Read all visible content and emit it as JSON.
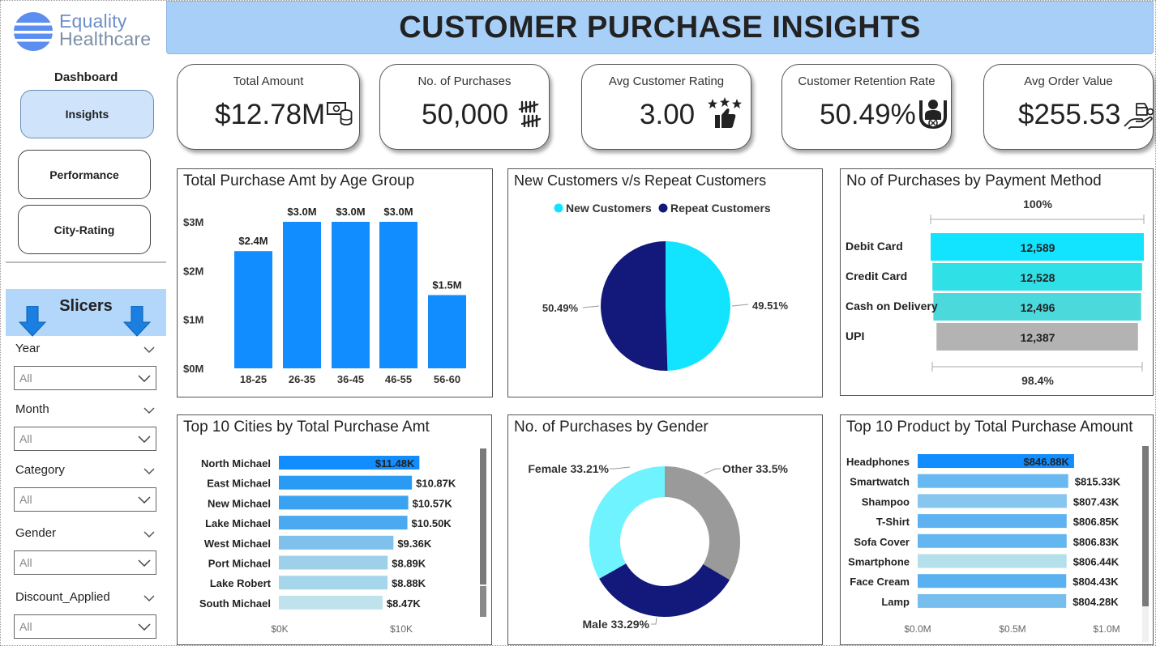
{
  "logo": {
    "line1": "Equality",
    "line2": "Healthcare"
  },
  "header": {
    "title": "CUSTOMER PURCHASE INSIGHTS"
  },
  "nav": {
    "title": "Dashboard",
    "items": [
      {
        "label": "Insights",
        "active": true
      },
      {
        "label": "Performance",
        "active": false
      },
      {
        "label": "City-Rating",
        "active": false
      }
    ]
  },
  "slicers": {
    "title": "Slicers",
    "items": [
      {
        "label": "Year",
        "value": "All"
      },
      {
        "label": "Month",
        "value": "All"
      },
      {
        "label": "Category",
        "value": "All"
      },
      {
        "label": "Gender",
        "value": "All"
      },
      {
        "label": "Discount_Applied",
        "value": "All"
      }
    ]
  },
  "kpis": [
    {
      "label": "Total Amount",
      "value": "$12.78M",
      "icon": "money-stack-icon"
    },
    {
      "label": "No. of Purchases",
      "value": "50,000",
      "icon": "tally-marks-icon"
    },
    {
      "label": "Avg Customer Rating",
      "value": "3.00",
      "icon": "rating-thumbs-up-icon"
    },
    {
      "label": "Customer Retention Rate",
      "value": "50.49%",
      "icon": "retention-person-icon"
    },
    {
      "label": "Avg Order Value",
      "value": "$255.53",
      "icon": "hand-coin-box-icon"
    }
  ],
  "colors": {
    "blue": "#118dff",
    "navy": "#12197a",
    "cyan": "#12e4ff",
    "grey": "#9a9a9a",
    "header": "#a8cff8"
  },
  "chart_data": [
    {
      "id": "age",
      "type": "bar",
      "title": "Total Purchase Amt by Age Group",
      "categories": [
        "18-25",
        "26-35",
        "36-45",
        "46-55",
        "56-60"
      ],
      "values": [
        2.4,
        3.0,
        3.0,
        3.0,
        1.5
      ],
      "value_labels": [
        "$2.4M",
        "$3.0M",
        "$3.0M",
        "$3.0M",
        "$1.5M"
      ],
      "yticks": [
        "$0M",
        "$1M",
        "$2M",
        "$3M"
      ],
      "ylim": [
        0,
        3
      ]
    },
    {
      "id": "newrepeat",
      "type": "pie",
      "title": "New Customers v/s Repeat Customers",
      "legend": [
        "New Customers",
        "Repeat Customers"
      ],
      "values": [
        49.51,
        50.49
      ],
      "labels": [
        "49.51%",
        "50.49%"
      ]
    },
    {
      "id": "payment",
      "type": "funnel",
      "title": "No of Purchases by Payment Method",
      "top_label": "100%",
      "bottom_label": "98.4%",
      "categories": [
        "Debit Card",
        "Credit Card",
        "Cash on Delivery",
        "UPI"
      ],
      "values": [
        12589,
        12528,
        12496,
        12387
      ],
      "value_labels": [
        "12,589",
        "12,528",
        "12,496",
        "12,387"
      ]
    },
    {
      "id": "cities",
      "type": "bar",
      "orientation": "horizontal",
      "title": "Top 10 Cities by Total Purchase Amt",
      "categories": [
        "North Michael",
        "East Michael",
        "New Michael",
        "Lake Michael",
        "West Michael",
        "Port Michael",
        "Lake Robert",
        "South Michael"
      ],
      "values": [
        11.48,
        10.87,
        10.57,
        10.5,
        9.36,
        8.89,
        8.88,
        8.47
      ],
      "value_labels": [
        "$11.48K",
        "$10.87K",
        "$10.57K",
        "$10.50K",
        "$9.36K",
        "$8.89K",
        "$8.88K",
        "$8.47K"
      ],
      "xticks": [
        "$0K",
        "$10K"
      ]
    },
    {
      "id": "gender",
      "type": "donut",
      "title": "No. of Purchases by Gender",
      "categories": [
        "Other",
        "Male",
        "Female"
      ],
      "values": [
        33.5,
        33.29,
        33.21
      ],
      "labels": [
        "Other 33.5%",
        "Male 33.29%",
        "Female 33.21%"
      ]
    },
    {
      "id": "products",
      "type": "bar",
      "orientation": "horizontal",
      "title": "Top 10 Product by Total Purchase Amount",
      "categories": [
        "Headphones",
        "Smartwatch",
        "Shampoo",
        "T-Shirt",
        "Sofa Cover",
        "Smartphone",
        "Face Cream",
        "Lamp"
      ],
      "values": [
        846.88,
        815.33,
        807.43,
        806.85,
        806.83,
        806.44,
        804.43,
        804.28
      ],
      "value_labels": [
        "$846.88K",
        "$815.33K",
        "$807.43K",
        "$806.85K",
        "$806.83K",
        "$806.44K",
        "$804.43K",
        "$804.28K"
      ],
      "xticks": [
        "$0.0M",
        "$0.5M",
        "$1.0M"
      ]
    }
  ]
}
